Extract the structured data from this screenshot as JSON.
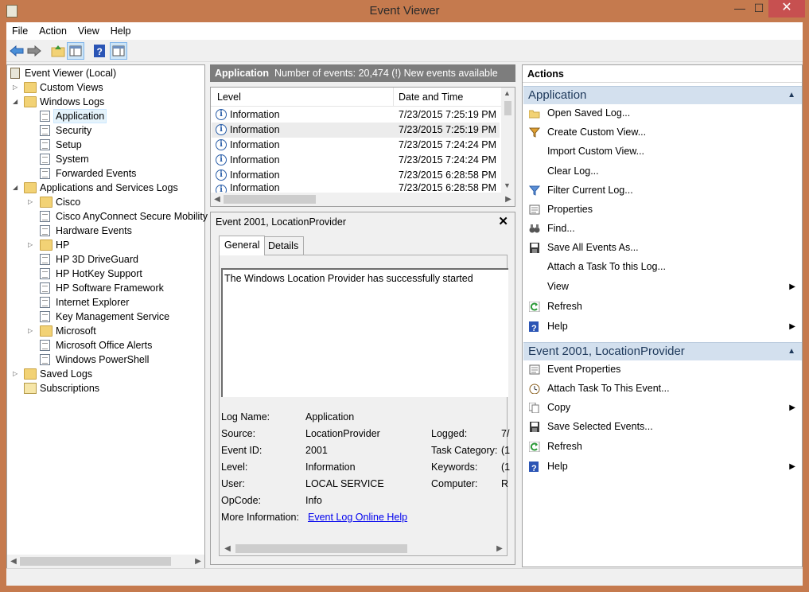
{
  "window": {
    "title": "Event Viewer",
    "minimize": "—",
    "maximize": "☐",
    "close": "✕"
  },
  "menu": [
    "File",
    "Action",
    "View",
    "Help"
  ],
  "tree": {
    "root": "Event Viewer (Local)",
    "custom_views": "Custom Views",
    "windows_logs": "Windows Logs",
    "application": "Application",
    "security": "Security",
    "setup": "Setup",
    "system": "System",
    "forwarded": "Forwarded Events",
    "app_services": "Applications and Services Logs",
    "cisco": "Cisco",
    "cisco_anyconnect": "Cisco AnyConnect Secure Mobility",
    "hardware": "Hardware Events",
    "hp": "HP",
    "hp3d": "HP 3D DriveGuard",
    "hphotkey": "HP HotKey Support",
    "hpsoftware": "HP Software Framework",
    "ie": "Internet Explorer",
    "kms": "Key Management Service",
    "microsoft": "Microsoft",
    "msoffice": "Microsoft Office Alerts",
    "powershell": "Windows PowerShell",
    "saved_logs": "Saved Logs",
    "subscriptions": "Subscriptions"
  },
  "center": {
    "log_name": "Application",
    "summary": "Number of events: 20,474 (!) New events available",
    "columns": [
      "Level",
      "Date and Time"
    ],
    "rows": [
      {
        "level": "Information",
        "date": "7/23/2015 7:25:19 PM"
      },
      {
        "level": "Information",
        "date": "7/23/2015 7:25:19 PM"
      },
      {
        "level": "Information",
        "date": "7/23/2015 7:24:24 PM"
      },
      {
        "level": "Information",
        "date": "7/23/2015 7:24:24 PM"
      },
      {
        "level": "Information",
        "date": "7/23/2015 6:28:58 PM"
      },
      {
        "level": "Information",
        "date": "7/23/2015 6:28:58 PM"
      }
    ]
  },
  "detail": {
    "title": "Event 2001, LocationProvider",
    "close": "✕",
    "tabs": [
      "General",
      "Details"
    ],
    "message": "The Windows Location Provider has successfully started",
    "fields": {
      "log_name_label": "Log Name:",
      "log_name": "Application",
      "source_label": "Source:",
      "source": "LocationProvider",
      "logged_label": "Logged:",
      "logged": "7/",
      "event_id_label": "Event ID:",
      "event_id": "2001",
      "task_label": "Task Category:",
      "task": "(1",
      "level_label": "Level:",
      "level": "Information",
      "keywords_label": "Keywords:",
      "keywords": "(1",
      "user_label": "User:",
      "user": "LOCAL SERVICE",
      "computer_label": "Computer:",
      "computer": "R",
      "opcode_label": "OpCode:",
      "opcode": "Info",
      "more_label": "More Information:",
      "more_link": "Event Log Online Help"
    }
  },
  "actions": {
    "header": "Actions",
    "section1": "Application",
    "items1": [
      "Open Saved Log...",
      "Create Custom View...",
      "Import Custom View...",
      "Clear Log...",
      "Filter Current Log...",
      "Properties",
      "Find...",
      "Save All Events As...",
      "Attach a Task To this Log...",
      "View",
      "Refresh",
      "Help"
    ],
    "section2": "Event 2001, LocationProvider",
    "items2": [
      "Event Properties",
      "Attach Task To This Event...",
      "Copy",
      "Save Selected Events...",
      "Refresh",
      "Help"
    ]
  },
  "colors": {
    "accent": "#c57a4e",
    "section": "#d3e0ee",
    "close": "#c75050"
  }
}
